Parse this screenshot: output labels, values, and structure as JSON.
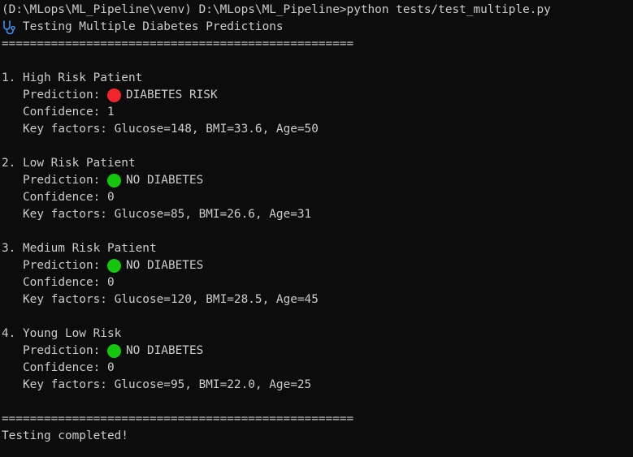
{
  "terminal": {
    "command_line": "(D:\\MLops\\ML_Pipeline\\venv) D:\\MLops\\ML_Pipeline>python tests/test_multiple.py",
    "header_icon": "stethoscope-icon",
    "header_title": "Testing Multiple Diabetes Predictions",
    "separator": "==================================================",
    "footer_separator": "==================================================",
    "footer": "Testing completed!"
  },
  "colors": {
    "background": "#0c0c0c",
    "text": "#cccccc",
    "risk_dot": "#f2242c",
    "safe_dot": "#16c60c",
    "icon": "#3b8eea"
  },
  "patients": [
    {
      "title": "1. High Risk Patient",
      "prediction_label": "Prediction:",
      "prediction_icon": "red-circle-icon",
      "prediction_value": "DIABETES RISK",
      "confidence": "Confidence: 1",
      "key_factors": "Key factors: Glucose=148, BMI=33.6, Age=50"
    },
    {
      "title": "2. Low Risk Patient",
      "prediction_label": "Prediction:",
      "prediction_icon": "green-circle-icon",
      "prediction_value": "NO DIABETES",
      "confidence": "Confidence: 0",
      "key_factors": "Key factors: Glucose=85, BMI=26.6, Age=31"
    },
    {
      "title": "3. Medium Risk Patient",
      "prediction_label": "Prediction:",
      "prediction_icon": "green-circle-icon",
      "prediction_value": "NO DIABETES",
      "confidence": "Confidence: 0",
      "key_factors": "Key factors: Glucose=120, BMI=28.5, Age=45"
    },
    {
      "title": "4. Young Low Risk",
      "prediction_label": "Prediction:",
      "prediction_icon": "green-circle-icon",
      "prediction_value": "NO DIABETES",
      "confidence": "Confidence: 0",
      "key_factors": "Key factors: Glucose=95, BMI=22.0, Age=25"
    }
  ]
}
